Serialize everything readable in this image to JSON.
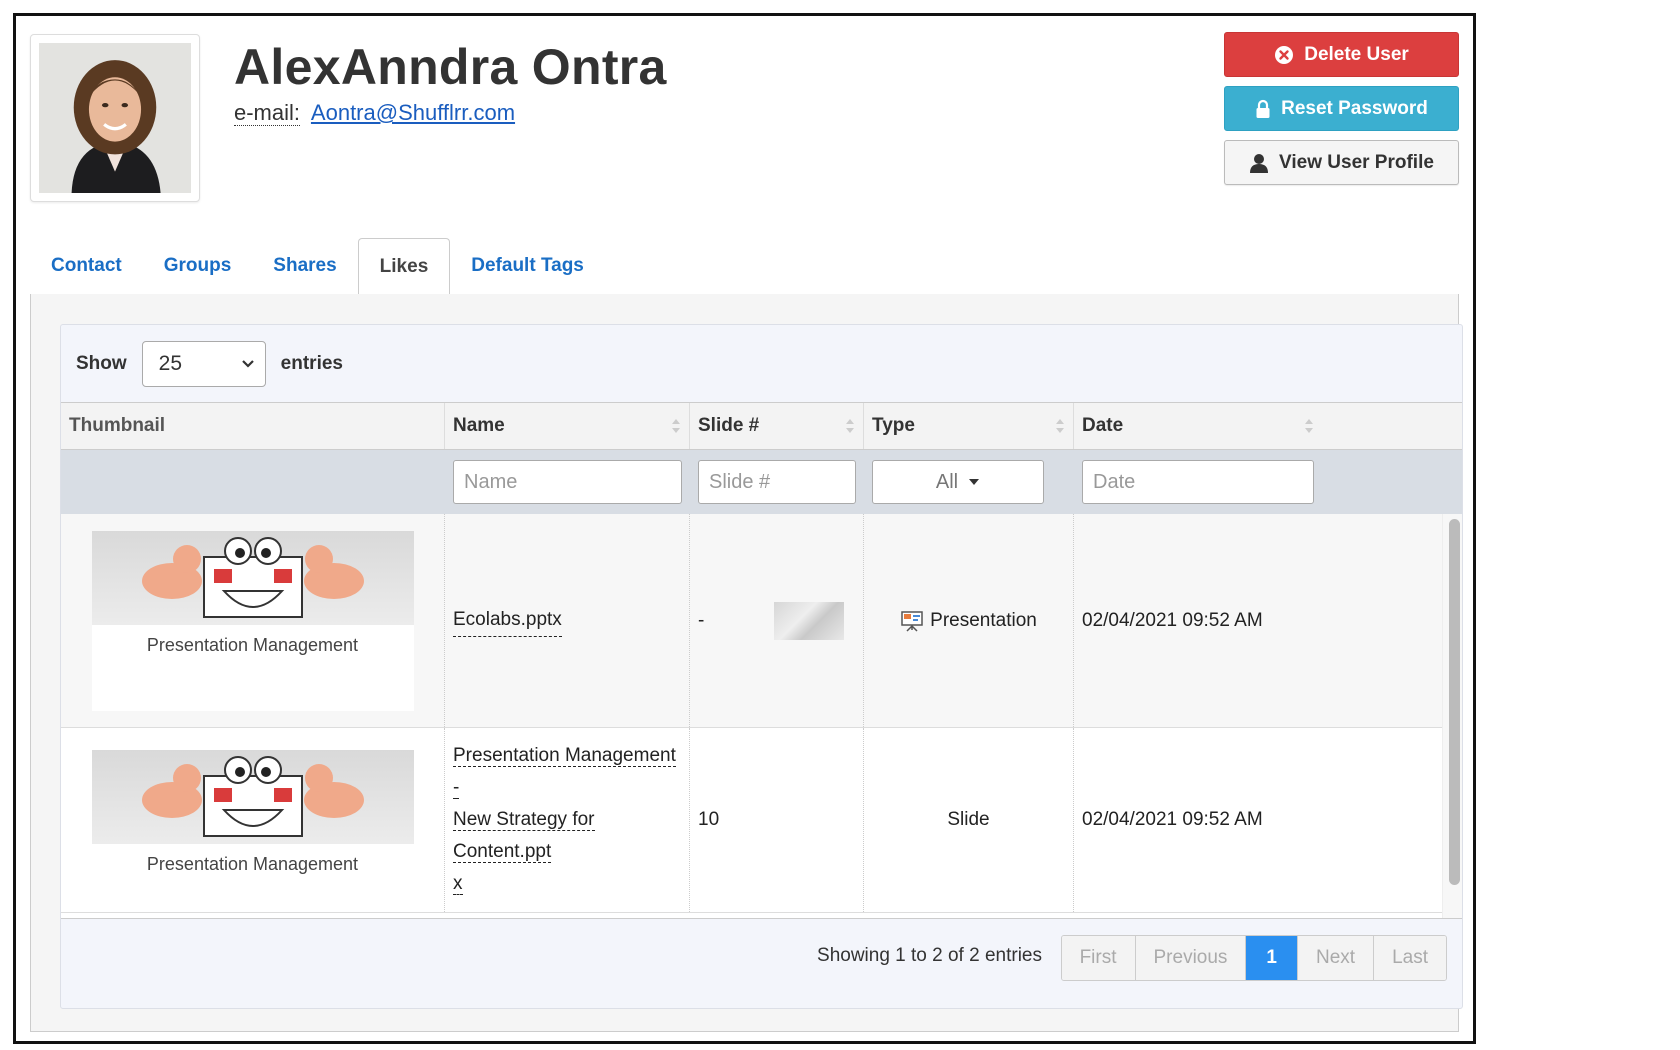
{
  "user": {
    "name": "AlexAnndra Ontra",
    "email_label": "e-mail:",
    "email": "Aontra@Shufflrr.com"
  },
  "actions": {
    "delete_label": "Delete User",
    "reset_label": "Reset Password",
    "view_label": "View User Profile"
  },
  "tabs": [
    {
      "label": "Contact"
    },
    {
      "label": "Groups"
    },
    {
      "label": "Shares"
    },
    {
      "label": "Likes",
      "active": true
    },
    {
      "label": "Default Tags"
    }
  ],
  "table": {
    "show_label": "Show",
    "page_size": "25",
    "entries_label": "entries",
    "columns": [
      "Thumbnail",
      "Name",
      "Slide #",
      "Type",
      "Date"
    ],
    "filters": {
      "name_placeholder": "Name",
      "slide_placeholder": "Slide #",
      "type_value": "All",
      "date_placeholder": "Date"
    },
    "rows": [
      {
        "thumbnail_caption": "Presentation Management",
        "name": "Ecolabs.pptx",
        "slide": "-",
        "type": "Presentation",
        "date": "02/04/2021 09:52 AM"
      },
      {
        "thumbnail_caption": "Presentation Management",
        "name_line1": "Presentation Management -",
        "name_line2": "New Strategy for Content.ppt",
        "name_line3": "x",
        "slide": "10",
        "type": "Slide",
        "date": "02/04/2021 09:52 AM"
      }
    ],
    "info": "Showing 1 to 2 of 2 entries",
    "pagination": [
      "First",
      "Previous",
      "1",
      "Next",
      "Last"
    ],
    "current_page": "1"
  },
  "colors": {
    "delete": "#dc3f3f",
    "reset": "#3bafd0",
    "link": "#1a6ec5",
    "active_page": "#2a8ff0"
  }
}
